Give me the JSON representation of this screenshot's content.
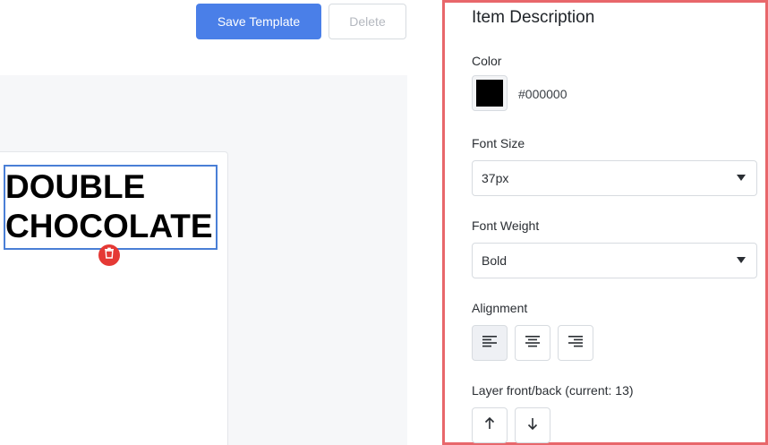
{
  "toolbar": {
    "save_label": "Save Template",
    "delete_label": "Delete"
  },
  "canvas": {
    "text_lines": [
      "DOUBLE",
      "CHOCOLATE"
    ],
    "text_color": "#000000"
  },
  "panel": {
    "title": "Item Description",
    "color": {
      "label": "Color",
      "value": "#000000"
    },
    "font_size": {
      "label": "Font Size",
      "value": "37px"
    },
    "font_weight": {
      "label": "Font Weight",
      "value": "Bold"
    },
    "alignment": {
      "label": "Alignment",
      "options": [
        "align-left-icon",
        "align-center-icon",
        "align-right-icon"
      ],
      "selected": "align-left-icon"
    },
    "layer": {
      "label": "Layer front/back (current: 13)"
    }
  },
  "colors": {
    "accent": "#4a7fe8",
    "panel_border": "#e8676b",
    "delete_badge": "#e53935",
    "selection_border": "#4a7fd6"
  }
}
